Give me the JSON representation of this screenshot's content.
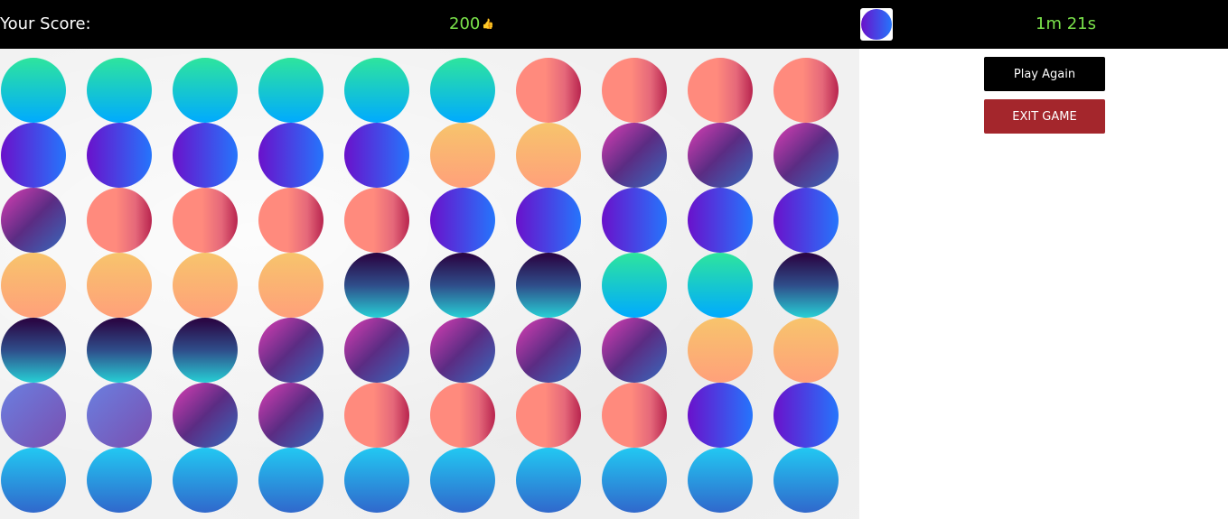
{
  "header": {
    "score_label": "Your Score:",
    "score_value": "200",
    "score_icon": "thumbs-up-icon",
    "current_color": "purple-blue",
    "timer": "1m 21s"
  },
  "buttons": {
    "play_again": "Play Again",
    "exit_game": "EXIT GAME"
  },
  "colors": {
    "header_bg": "#000000",
    "accent_green": "#7be34b",
    "exit_red": "#a4262c"
  },
  "palette": {
    "green": "linear-gradient(to bottom, #2ee59d, #00aaff)",
    "purple-blue": "linear-gradient(to right, #6a11cb, #2575fc)",
    "salmon": "linear-gradient(to right, #ff8a7d 0%, #ff8a7d 45%, #e5687a 75%, #b8244e 100%)",
    "peach": "linear-gradient(to bottom, #f7c46c, #ffa07a)",
    "magenta": "linear-gradient(135deg, #c23bab 10%, #5b2c83 50%, #3a64b8 95%)",
    "navy": "linear-gradient(to bottom, #2a0845 5%, #2f4d8a 50%, #27d0d6 100%)",
    "lavender": "linear-gradient(135deg, #6a7fe0, #7a4fb0)",
    "sky": "linear-gradient(to bottom, #22c8f2, #3068cc)"
  },
  "board": [
    [
      "green",
      "green",
      "green",
      "green",
      "green",
      "green",
      "salmon",
      "salmon",
      "salmon",
      "salmon"
    ],
    [
      "purple-blue",
      "purple-blue",
      "purple-blue",
      "purple-blue",
      "purple-blue",
      "peach",
      "peach",
      "magenta",
      "magenta",
      "magenta"
    ],
    [
      "magenta",
      "salmon",
      "salmon",
      "salmon",
      "salmon",
      "purple-blue",
      "purple-blue",
      "purple-blue",
      "purple-blue",
      "purple-blue"
    ],
    [
      "peach",
      "peach",
      "peach",
      "peach",
      "navy",
      "navy",
      "navy",
      "green",
      "green",
      "navy"
    ],
    [
      "navy",
      "navy",
      "navy",
      "magenta",
      "magenta",
      "magenta",
      "magenta",
      "magenta",
      "peach",
      "peach"
    ],
    [
      "lavender",
      "lavender",
      "magenta",
      "magenta",
      "salmon",
      "salmon",
      "salmon",
      "salmon",
      "purple-blue",
      "purple-blue"
    ],
    [
      "sky",
      "sky",
      "sky",
      "sky",
      "sky",
      "sky",
      "sky",
      "sky",
      "sky",
      "sky"
    ]
  ]
}
